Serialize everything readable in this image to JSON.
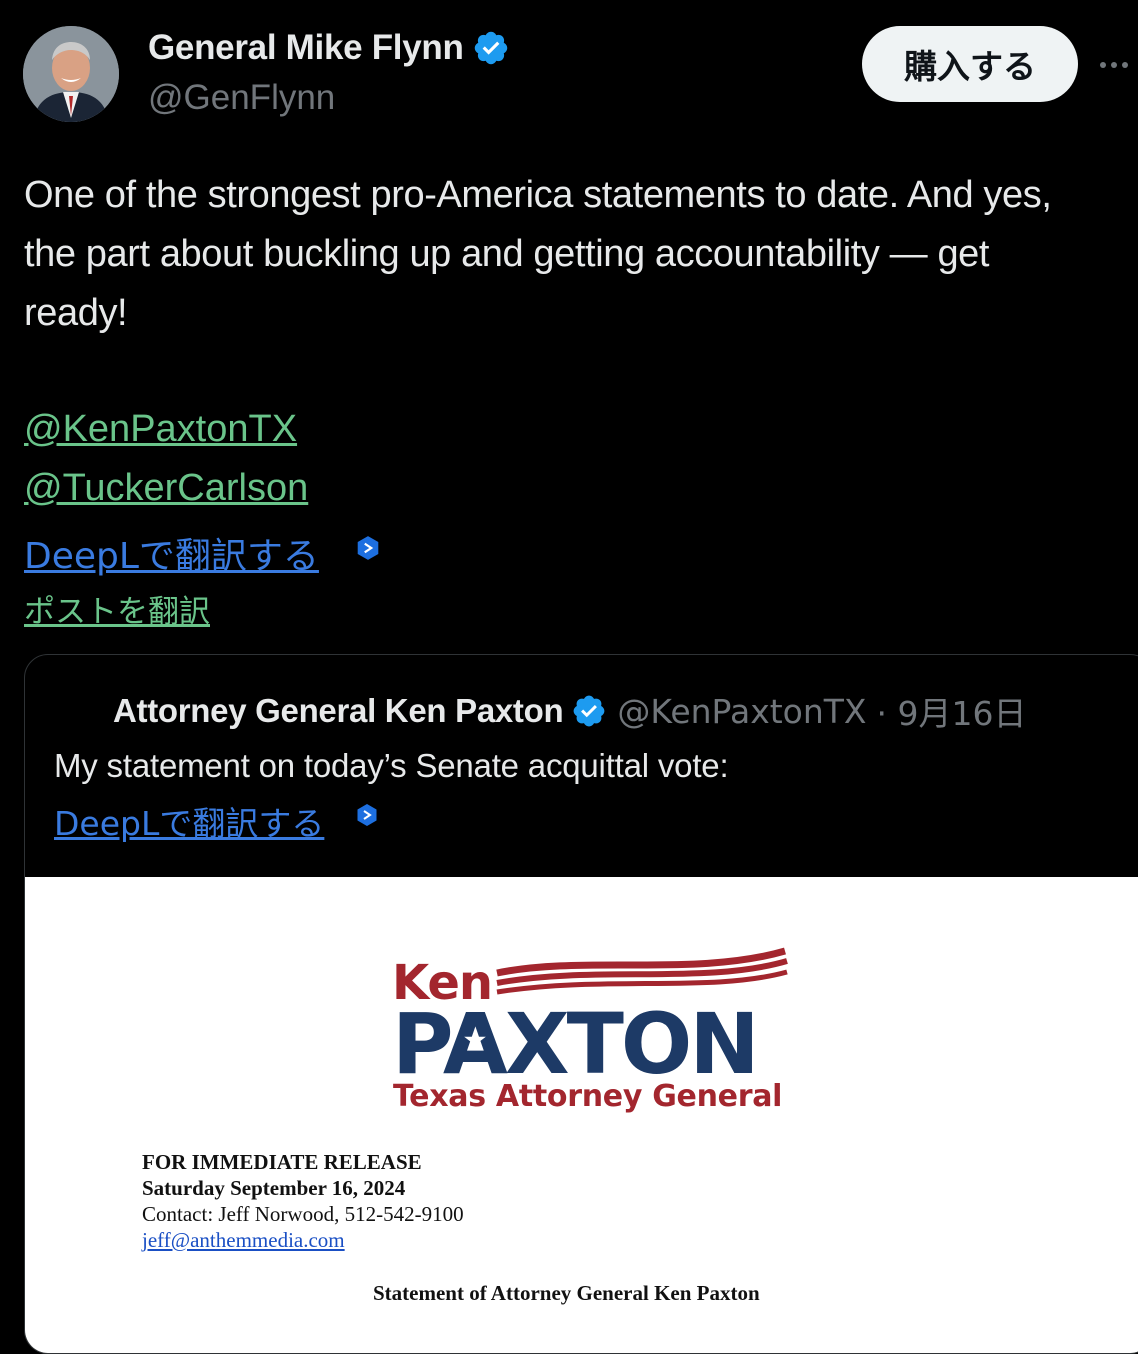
{
  "author": {
    "name": "General Mike Flynn",
    "handle": "@GenFlynn"
  },
  "buy_button_label": "購入する",
  "tweet": {
    "line1": "One of the strongest pro-America statements to date. And yes,",
    "line2": "the part about buckling up and getting accountability — get",
    "line3": "ready!",
    "mention1": "@KenPaxtonTX",
    "mention2": "@TuckerCarlson",
    "deepl_label": "DeepLで翻訳する",
    "translate_label": "ポストを翻訳"
  },
  "quote": {
    "name": "Attorney General Ken Paxton",
    "handle": "@KenPaxtonTX",
    "date": "· 9月16日",
    "text": "My statement on today’s Senate acquittal vote:",
    "deepl_label": "DeepLで翻訳する"
  },
  "document": {
    "logo_ken": "Ken",
    "logo_paxton": "PAXTON",
    "logo_subtitle": "Texas Attorney General",
    "release": "FOR IMMEDIATE RELEASE",
    "date": "Saturday September 16, 2024",
    "contact": "Contact: Jeff Norwood, 512-542-9100",
    "email": "jeff@anthemmedia.com",
    "statement_title": "Statement of Attorney General Ken Paxton"
  },
  "colors": {
    "background": "#000000",
    "verified_badge": "#1d9bf0",
    "mention_link": "#6ac48a",
    "deepl_link": "#3a7be0",
    "logo_red": "#a3262e",
    "logo_navy": "#1d3a66"
  },
  "icons": [
    "verified-badge-icon",
    "more-options-icon",
    "deepl-icon"
  ]
}
